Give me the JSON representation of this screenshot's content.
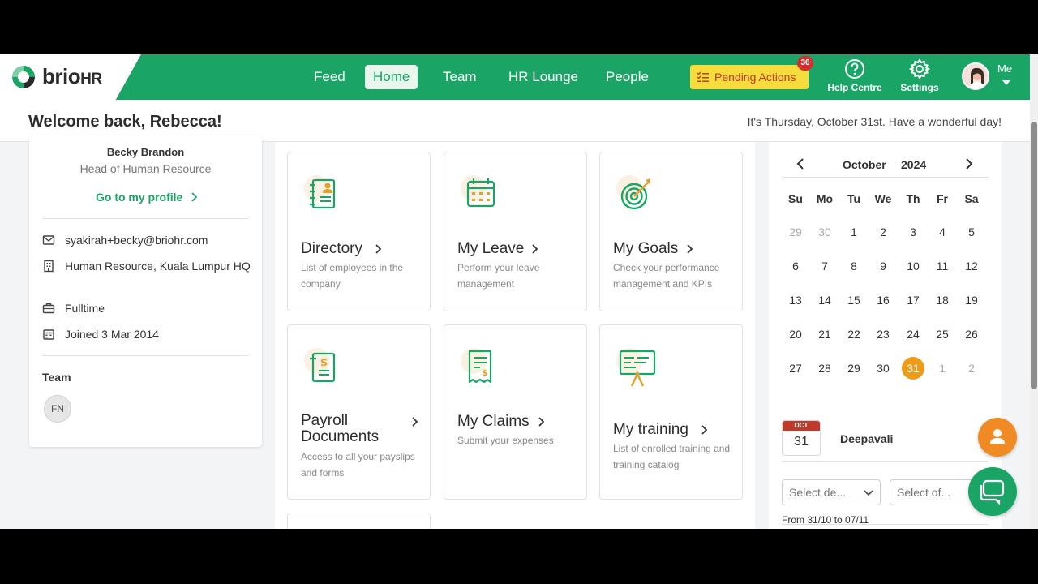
{
  "brand": {
    "name": "brio",
    "suffix": "HR",
    "color": "#1aa566"
  },
  "nav": {
    "items": [
      {
        "label": "Feed"
      },
      {
        "label": "Home",
        "active": true
      },
      {
        "label": "Team"
      },
      {
        "label": "HR Lounge"
      },
      {
        "label": "People"
      }
    ],
    "pending_label": "Pending Actions",
    "pending_count": "36",
    "help_label": "Help Centre",
    "settings_label": "Settings",
    "me_label": "Me"
  },
  "welcome": {
    "title": "Welcome back, Rebecca!",
    "date_text": "It's Thursday, October 31st. Have a wonderful day!"
  },
  "profile": {
    "name": "Becky Brandon",
    "role": "Head of Human Resource",
    "profile_link": "Go to my profile",
    "email": "syakirah+becky@briohr.com",
    "location": "Human Resource, Kuala Lumpur HQ",
    "employment": "Fulltime",
    "joined": "Joined 3 Mar 2014",
    "team_label": "Team",
    "team_members": [
      "FN"
    ]
  },
  "tiles": [
    {
      "title": "Directory",
      "desc": "List of employees in the company",
      "icon": "directory-icon"
    },
    {
      "title": "My Leave",
      "desc": "Perform your leave management",
      "icon": "calendar-icon"
    },
    {
      "title": "My Goals",
      "desc": "Check your performance management and KPIs",
      "icon": "target-icon"
    },
    {
      "title": "Payroll Documents",
      "desc": "Access to all your payslips and forms",
      "icon": "payroll-icon"
    },
    {
      "title": "My Claims",
      "desc": "Submit your expenses",
      "icon": "receipt-icon"
    },
    {
      "title": "My training",
      "desc": "List of enrolled training and training catalog",
      "icon": "training-icon"
    }
  ],
  "calendar": {
    "month": "October",
    "year": "2024",
    "weekdays": [
      "Su",
      "Mo",
      "Tu",
      "We",
      "Th",
      "Fr",
      "Sa"
    ],
    "weeks": [
      [
        "29",
        "30",
        "1",
        "2",
        "3",
        "4",
        "5"
      ],
      [
        "6",
        "7",
        "8",
        "9",
        "10",
        "11",
        "12"
      ],
      [
        "13",
        "14",
        "15",
        "16",
        "17",
        "18",
        "19"
      ],
      [
        "20",
        "21",
        "22",
        "23",
        "24",
        "25",
        "26"
      ],
      [
        "27",
        "28",
        "29",
        "30",
        "31",
        "1",
        "2"
      ]
    ],
    "today": "31",
    "today_color": "#f09a1a",
    "event": {
      "month": "OCT",
      "day": "31",
      "name": "Deepavali"
    },
    "select_dept_placeholder": "Select de...",
    "select_office_placeholder": "Select of...",
    "range_text": "From 31/10 to 07/11"
  }
}
